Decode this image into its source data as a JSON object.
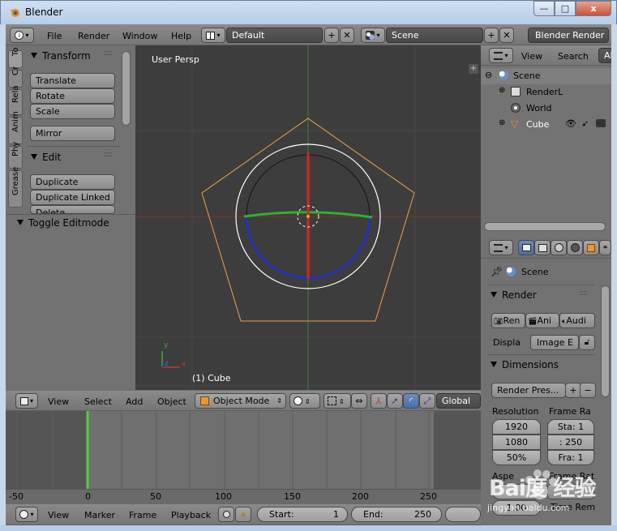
{
  "window": {
    "title": "Blender",
    "controls": {
      "minimize": "—",
      "maximize": "□",
      "close": "x"
    }
  },
  "top_header": {
    "info_icon": "info-icon",
    "menus": [
      "File",
      "Render",
      "Window",
      "Help"
    ],
    "layout_value": "Default",
    "scene_value": "Scene",
    "engine_value": "Blender Render"
  },
  "tool_shelf": {
    "tabs": [
      "To",
      "Cr",
      "Rela",
      "Anim",
      "Phy",
      "Grease"
    ],
    "transform_panel": "Transform",
    "transform_buttons": [
      "Translate",
      "Rotate",
      "Scale"
    ],
    "mirror_button": "Mirror",
    "edit_panel": "Edit",
    "edit_buttons": [
      "Duplicate",
      "Duplicate Linked",
      "Delete"
    ],
    "toggle_editmode": "Toggle Editmode"
  },
  "viewport": {
    "view_label": "User Persp",
    "object_label": "(1) Cube",
    "axis_x": "x",
    "axis_y": "y",
    "axis_z": "z"
  },
  "viewport_header": {
    "menus": [
      "View",
      "Select",
      "Add",
      "Object"
    ],
    "mode_value": "Object Mode",
    "orientation_value": "Global"
  },
  "timeline": {
    "ruler_numbers": [
      "-50",
      "0",
      "50",
      "100",
      "150",
      "200",
      "250"
    ],
    "current_frame_marker": 0,
    "menus": [
      "View",
      "Marker",
      "Frame",
      "Playback"
    ],
    "start_label": "Start:",
    "start_value": "1",
    "end_label": "End:",
    "end_value": "250"
  },
  "outliner": {
    "header_menus": [
      "View",
      "Search",
      "Al"
    ],
    "items": [
      "Scene",
      "RenderL",
      "World",
      "Cube"
    ]
  },
  "properties": {
    "context": "Scene",
    "render_panel": "Render",
    "render_buttons": [
      "Ren",
      "Ani",
      "Audi"
    ],
    "display_label": "Displa",
    "display_value": "Image E",
    "dimensions_panel": "Dimensions",
    "render_presets": "Render Pres...",
    "resolution_label": "Resolution",
    "frame_range_label": "Frame Ra",
    "res_x": "1920",
    "res_y": "1080",
    "res_pct": "50%",
    "frame_start": "Sta: 1",
    "frame_end": ": 250",
    "frame_step": "Fra: 1",
    "aspect_label": "Aspe",
    "frame_rate_label": "Frame Rat",
    "aspect_value": "1.00",
    "time_remap_label": "Time Rem"
  },
  "watermark": {
    "brand": "Bai度 经验",
    "url": "jingyan.baidu.com"
  },
  "colors": {
    "viewport_bg": "#3d3d3d",
    "selection_orange": "#f0a040",
    "axis_red": "#d03030",
    "axis_green": "#30b030",
    "axis_blue": "#2030d0",
    "playhead_green": "#4cd03a"
  }
}
